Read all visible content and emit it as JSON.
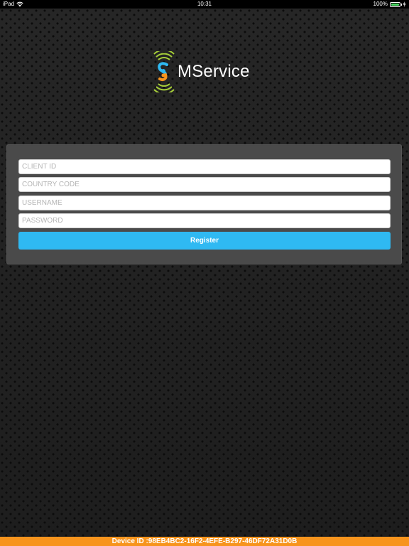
{
  "status_bar": {
    "device": "iPad",
    "time": "10:31",
    "battery": "100%",
    "battery_level": 1.0,
    "wifi_icon": "wifi-icon",
    "battery_icon": "battery-icon",
    "charge_icon": "charging-bolt-icon"
  },
  "logo": {
    "text": "MService",
    "icon": "mservice-logo-icon",
    "colors": {
      "waves": "#a6ce39",
      "s_blue": "#2fb9f2",
      "s_orange": "#f7941d"
    }
  },
  "form": {
    "client_id_placeholder": "CLIENT ID",
    "client_id_value": "",
    "country_code_placeholder": "COUNTRY CODE",
    "country_code_value": "",
    "username_placeholder": "USERNAME",
    "username_value": "",
    "password_placeholder": "PASSWORD",
    "password_value": "",
    "register_label": "Register"
  },
  "footer": {
    "device_id": "Device ID :98EB4BC2-16F2-4EFE-B297-46DF72A31D0B"
  },
  "colors": {
    "accent": "#2fb9f2",
    "footer": "#f7941d",
    "panel": "#4a4a4a",
    "background": "#1a1a1a"
  }
}
